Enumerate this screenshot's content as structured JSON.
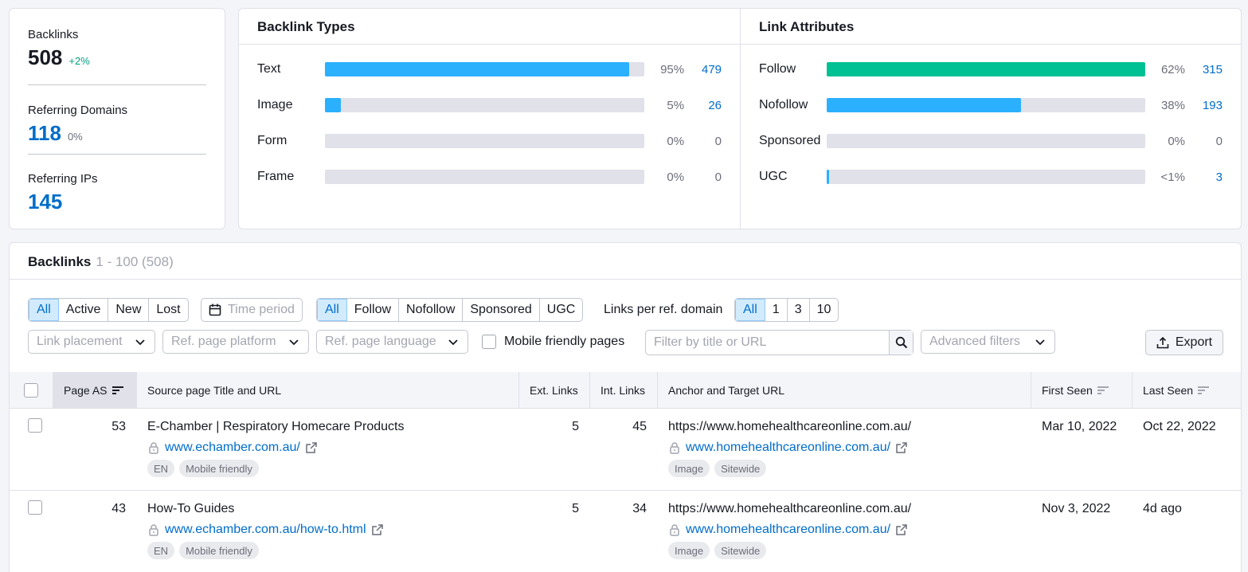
{
  "summary": {
    "backlinks": {
      "label": "Backlinks",
      "value": "508",
      "delta": "+2%"
    },
    "referring_domains": {
      "label": "Referring Domains",
      "value": "118",
      "delta": "0%"
    },
    "referring_ips": {
      "label": "Referring IPs",
      "value": "145"
    }
  },
  "backlink_types": {
    "title": "Backlink Types",
    "rows": [
      {
        "label": "Text",
        "pct_text": "95%",
        "count": "479",
        "share": 0.95,
        "color": "#2bb0fd"
      },
      {
        "label": "Image",
        "pct_text": "5%",
        "count": "26",
        "share": 0.05,
        "color": "#2bb0fd"
      },
      {
        "label": "Form",
        "pct_text": "0%",
        "count": "0",
        "share": 0,
        "color": "#2bb0fd"
      },
      {
        "label": "Frame",
        "pct_text": "0%",
        "count": "0",
        "share": 0,
        "color": "#2bb0fd"
      }
    ]
  },
  "link_attributes": {
    "title": "Link Attributes",
    "rows": [
      {
        "label": "Follow",
        "pct_text": "62%",
        "count": "315",
        "share": 1.0,
        "color": "#00c193"
      },
      {
        "label": "Nofollow",
        "pct_text": "38%",
        "count": "193",
        "share": 0.61,
        "color": "#2bb0fd"
      },
      {
        "label": "Sponsored",
        "pct_text": "0%",
        "count": "0",
        "share": 0,
        "color": "#2bb0fd"
      },
      {
        "label": "UGC",
        "pct_text": "<1%",
        "count": "3",
        "share": 0.006,
        "color": "#2bb0fd"
      }
    ]
  },
  "table_header": {
    "title": "Backlinks",
    "range": "1 - 100 (508)"
  },
  "filters": {
    "status": [
      "All",
      "Active",
      "New",
      "Lost"
    ],
    "time_period": "Time period",
    "attributes": [
      "All",
      "Follow",
      "Nofollow",
      "Sponsored",
      "UGC"
    ],
    "links_per_domain_label": "Links per ref. domain",
    "links_per_domain": [
      "All",
      "1",
      "3",
      "10"
    ],
    "link_placement": "Link placement",
    "ref_platform": "Ref. page platform",
    "ref_language": "Ref. page language",
    "mobile_friendly": "Mobile friendly pages",
    "search_placeholder": "Filter by title or URL",
    "advanced": "Advanced filters",
    "export": "Export"
  },
  "columns": {
    "page_as": "Page AS",
    "source": "Source page Title and URL",
    "ext_links": "Ext. Links",
    "int_links": "Int. Links",
    "anchor": "Anchor and Target URL",
    "first_seen": "First Seen",
    "last_seen": "Last Seen"
  },
  "rows": [
    {
      "page_as": "53",
      "title": "E-Chamber | Respiratory Homecare Products",
      "domain": "www.echamber.com.au",
      "path": "/",
      "tags": [
        "EN",
        "Mobile friendly"
      ],
      "ext_links": "5",
      "int_links": "45",
      "anchor": "https://www.homehealthcareonline.com.au/",
      "target": "www.homehealthcareonline.com.au/",
      "anchor_tags": [
        "Image",
        "Sitewide"
      ],
      "first_seen": "Mar 10, 2022",
      "last_seen": "Oct 22, 2022"
    },
    {
      "page_as": "43",
      "title": "How-To Guides",
      "domain": "www.echamber.com.au",
      "path": "/how-to.html",
      "tags": [
        "EN",
        "Mobile friendly"
      ],
      "ext_links": "5",
      "int_links": "34",
      "anchor": "https://www.homehealthcareonline.com.au/",
      "target": "www.homehealthcareonline.com.au/",
      "anchor_tags": [
        "Image",
        "Sitewide"
      ],
      "first_seen": "Nov 3, 2022",
      "last_seen": "4d ago"
    }
  ]
}
